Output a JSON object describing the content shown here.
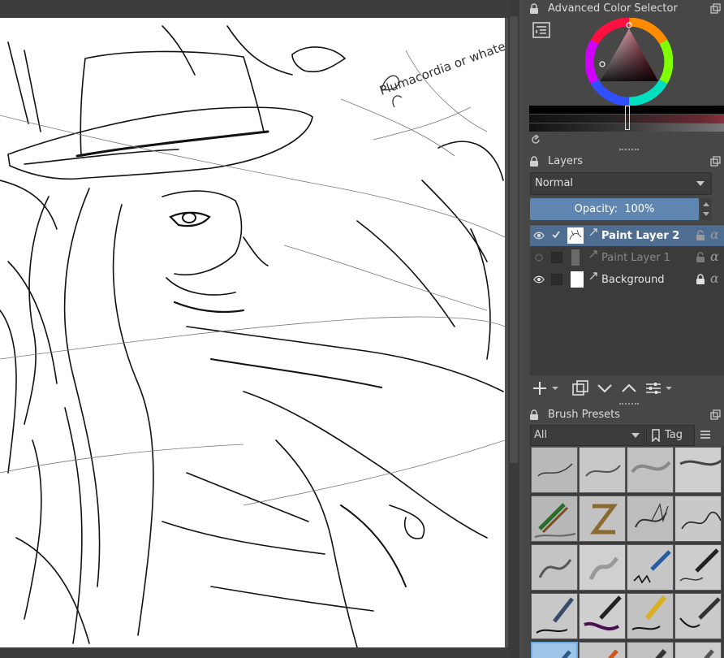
{
  "canvas": {
    "annotation": "Plumacordia or whatever",
    "layer_content": "sketch"
  },
  "color_selector": {
    "title": "Advanced Color Selector",
    "icon": "list-settings-icon",
    "hue_ring": "hsv-ring",
    "reset_icon": "refresh-icon"
  },
  "layers": {
    "title": "Layers",
    "blend_mode": "Normal",
    "opacity_label": "Opacity:",
    "opacity_value": "100%",
    "items": [
      {
        "name": "Paint Layer 2",
        "visible": true,
        "selected": true,
        "checked": true
      },
      {
        "name": "Paint Layer 1",
        "visible": false,
        "selected": false,
        "checked": false
      },
      {
        "name": "Background",
        "visible": true,
        "selected": false,
        "checked": false,
        "locked": true
      }
    ],
    "tools": [
      "add-layer-icon",
      "duplicate-layer-icon",
      "move-down-icon",
      "move-up-icon",
      "layer-properties-icon"
    ]
  },
  "brushes": {
    "title": "Brush Presets",
    "filter": "All",
    "tag_label": "Tag",
    "preset_icons": [
      "basic-pencil",
      "soft-pencil",
      "airbrush",
      "ink-stroke",
      "colored-pencils",
      "chalk-zigzag",
      "dry-brush",
      "fine-ink",
      "blender-smudge",
      "smooth-blender",
      "pen-nib-blue",
      "ink-pen-black",
      "fountain-pen",
      "brush-pen-purple",
      "calligraphy-pen",
      "marker-tip",
      "technical-pen-blue",
      "watercolor-brush",
      "charcoal-stick",
      "pencil-dark"
    ]
  },
  "colors": {
    "accent": "#5f86b0",
    "selected_row": "#4e6d90",
    "panel_bg": "#474747",
    "list_bg": "#3b3b3b"
  }
}
